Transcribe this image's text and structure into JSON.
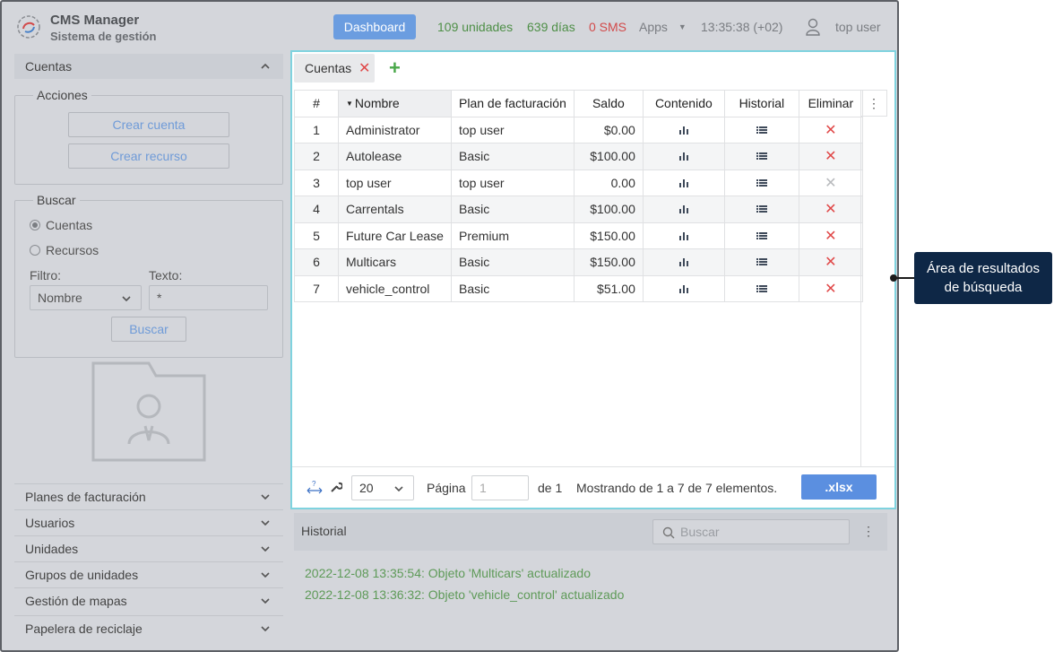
{
  "header": {
    "app_title": "CMS Manager",
    "app_subtitle": "Sistema de gestión",
    "dashboard_label": "Dashboard",
    "units": "109 unidades",
    "days": "639 días",
    "sms": "0 SMS",
    "apps_label": "Apps",
    "time": "13:35:38 (+02)",
    "user": "top user"
  },
  "sidebar": {
    "accounts_header": "Cuentas",
    "actions": {
      "legend": "Acciones",
      "create_account": "Crear cuenta",
      "create_resource": "Crear recurso"
    },
    "search": {
      "legend": "Buscar",
      "radio_accounts": "Cuentas",
      "radio_resources": "Recursos",
      "filter_label": "Filtro:",
      "text_label": "Texto:",
      "filter_value": "Nombre",
      "text_value": "*",
      "search_button": "Buscar"
    },
    "nav": [
      "Planes de facturación",
      "Usuarios",
      "Unidades",
      "Grupos de unidades",
      "Gestión de mapas",
      "Papelera de reciclaje"
    ]
  },
  "main": {
    "tab_label": "Cuentas",
    "columns": [
      "#",
      "Nombre",
      "Plan de facturación",
      "Saldo",
      "Contenido",
      "Historial",
      "Eliminar"
    ],
    "rows": [
      {
        "n": "1",
        "name": "Administrator",
        "plan": "top user",
        "balance": "$0.00",
        "deletable": true
      },
      {
        "n": "2",
        "name": "Autolease",
        "plan": "Basic",
        "balance": "$100.00",
        "deletable": true
      },
      {
        "n": "3",
        "name": "top user",
        "plan": "top user",
        "balance": "0.00",
        "deletable": false
      },
      {
        "n": "4",
        "name": "Carrentals",
        "plan": "Basic",
        "balance": "$100.00",
        "deletable": true
      },
      {
        "n": "5",
        "name": "Future Car Lease",
        "plan": "Premium",
        "balance": "$150.00",
        "deletable": true
      },
      {
        "n": "6",
        "name": "Multicars",
        "plan": "Basic",
        "balance": "$150.00",
        "deletable": true
      },
      {
        "n": "7",
        "name": "vehicle_control",
        "plan": "Basic",
        "balance": "$51.00",
        "deletable": true
      }
    ],
    "pager": {
      "page_size": "20",
      "page_label": "Página",
      "page_value": "1",
      "of_label": "de 1",
      "showing": "Mostrando de 1 a 7 de 7 elementos.",
      "export_label": ".xlsx"
    }
  },
  "history": {
    "title": "Historial",
    "search_placeholder": "Buscar",
    "entries": [
      "2022-12-08 13:35:54: Objeto 'Multicars' actualizado",
      "2022-12-08 13:36:32: Objeto 'vehicle_control' actualizado"
    ]
  },
  "callout": {
    "line1": "Área de resultados",
    "line2": "de búsqueda"
  },
  "colors": {
    "accent": "#5b8fe0",
    "panel_border": "#7fd3df",
    "delete": "#e04848",
    "positive": "#4e8f47",
    "callout_bg": "#0e2746"
  }
}
